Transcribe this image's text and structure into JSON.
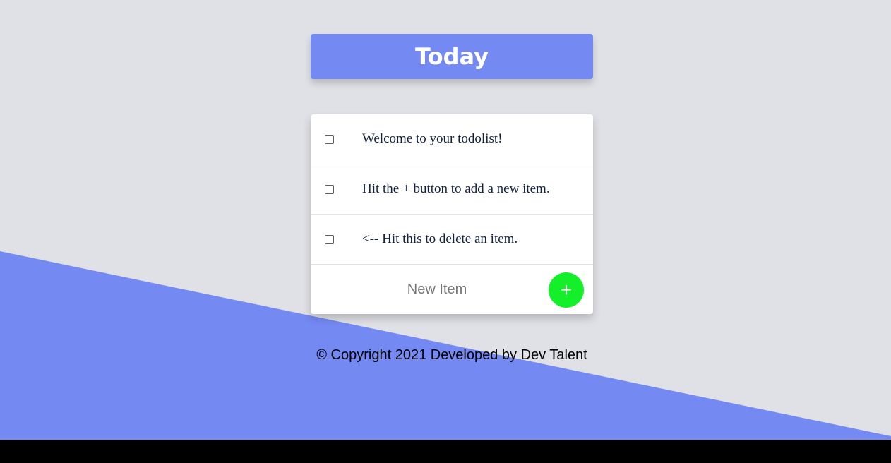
{
  "colors": {
    "background": "#e0e1e6",
    "accent": "#7589f3",
    "add_button": "#13f02a",
    "bottom_bar": "#000000"
  },
  "header": {
    "title": "Today"
  },
  "list": {
    "items": [
      {
        "label": "Welcome to your todolist!",
        "checked": false
      },
      {
        "label": "Hit the + button to add a new item.",
        "checked": false
      },
      {
        "label": "<-- Hit this to delete an item.",
        "checked": false
      }
    ],
    "new_item": {
      "placeholder": "New Item",
      "value": ""
    },
    "add_button_label": "+",
    "add_button_icon": "plus-icon"
  },
  "footer": {
    "text": "© Copyright 2021 Developed by Dev Talent"
  }
}
